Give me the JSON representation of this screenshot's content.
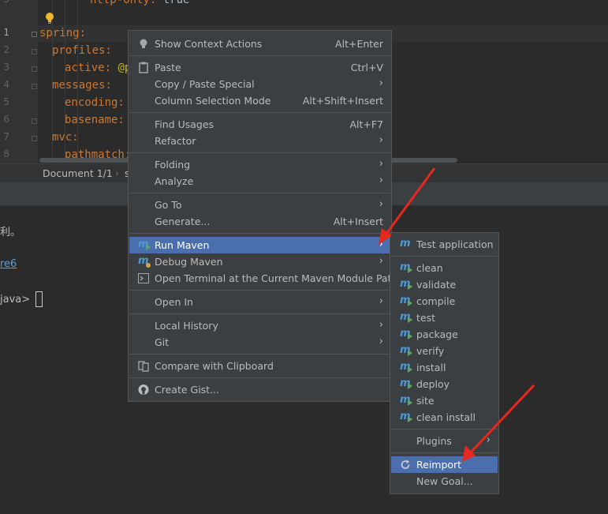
{
  "editor": {
    "line_numbers": [
      "3",
      "1",
      "2",
      "3",
      "4",
      "5",
      "6",
      "7",
      "8"
    ],
    "lines": [
      {
        "key": "http-only:",
        "value": "true"
      },
      {
        "key": "spring:",
        "value": ""
      },
      {
        "key": "profiles:",
        "value": ""
      },
      {
        "key": "active:",
        "value": "@p"
      },
      {
        "key": "messages:",
        "value": ""
      },
      {
        "key": "encoding:",
        "value": ""
      },
      {
        "key": "basename:",
        "value": ""
      },
      {
        "key": "mvc:",
        "value": ""
      },
      {
        "key": "pathmatch:",
        "value": ""
      }
    ]
  },
  "breadcrumb": {
    "document": "Document 1/1",
    "sep": "›",
    "next": "s"
  },
  "terminal": {
    "line1": "利。",
    "line2": "re6",
    "prompt": "java>"
  },
  "context_menu": {
    "show_context_actions": "Show Context Actions",
    "show_context_actions_shortcut": "Alt+Enter",
    "paste": "Paste",
    "paste_shortcut": "Ctrl+V",
    "copy_paste_special": "Copy / Paste Special",
    "column_selection_mode": "Column Selection Mode",
    "column_selection_mode_shortcut": "Alt+Shift+Insert",
    "find_usages": "Find Usages",
    "find_usages_shortcut": "Alt+F7",
    "refactor": "Refactor",
    "folding": "Folding",
    "analyze": "Analyze",
    "go_to": "Go To",
    "generate": "Generate...",
    "generate_shortcut": "Alt+Insert",
    "run_maven": "Run Maven",
    "debug_maven": "Debug Maven",
    "open_terminal": "Open Terminal at the Current Maven Module Path",
    "open_in": "Open In",
    "local_history": "Local History",
    "git": "Git",
    "compare_clipboard": "Compare with Clipboard",
    "create_gist": "Create Gist..."
  },
  "maven_submenu": {
    "test_application": "Test application",
    "goals": [
      "clean",
      "validate",
      "compile",
      "test",
      "package",
      "verify",
      "install",
      "deploy",
      "site",
      "clean install"
    ],
    "plugins": "Plugins",
    "reimport": "Reimport",
    "new_goal": "New Goal..."
  },
  "colors": {
    "selection": "#4b6eaf",
    "menu_bg": "#3c3f41",
    "arrow": "#e8281e",
    "maven_icon": "#4a9ad6"
  }
}
